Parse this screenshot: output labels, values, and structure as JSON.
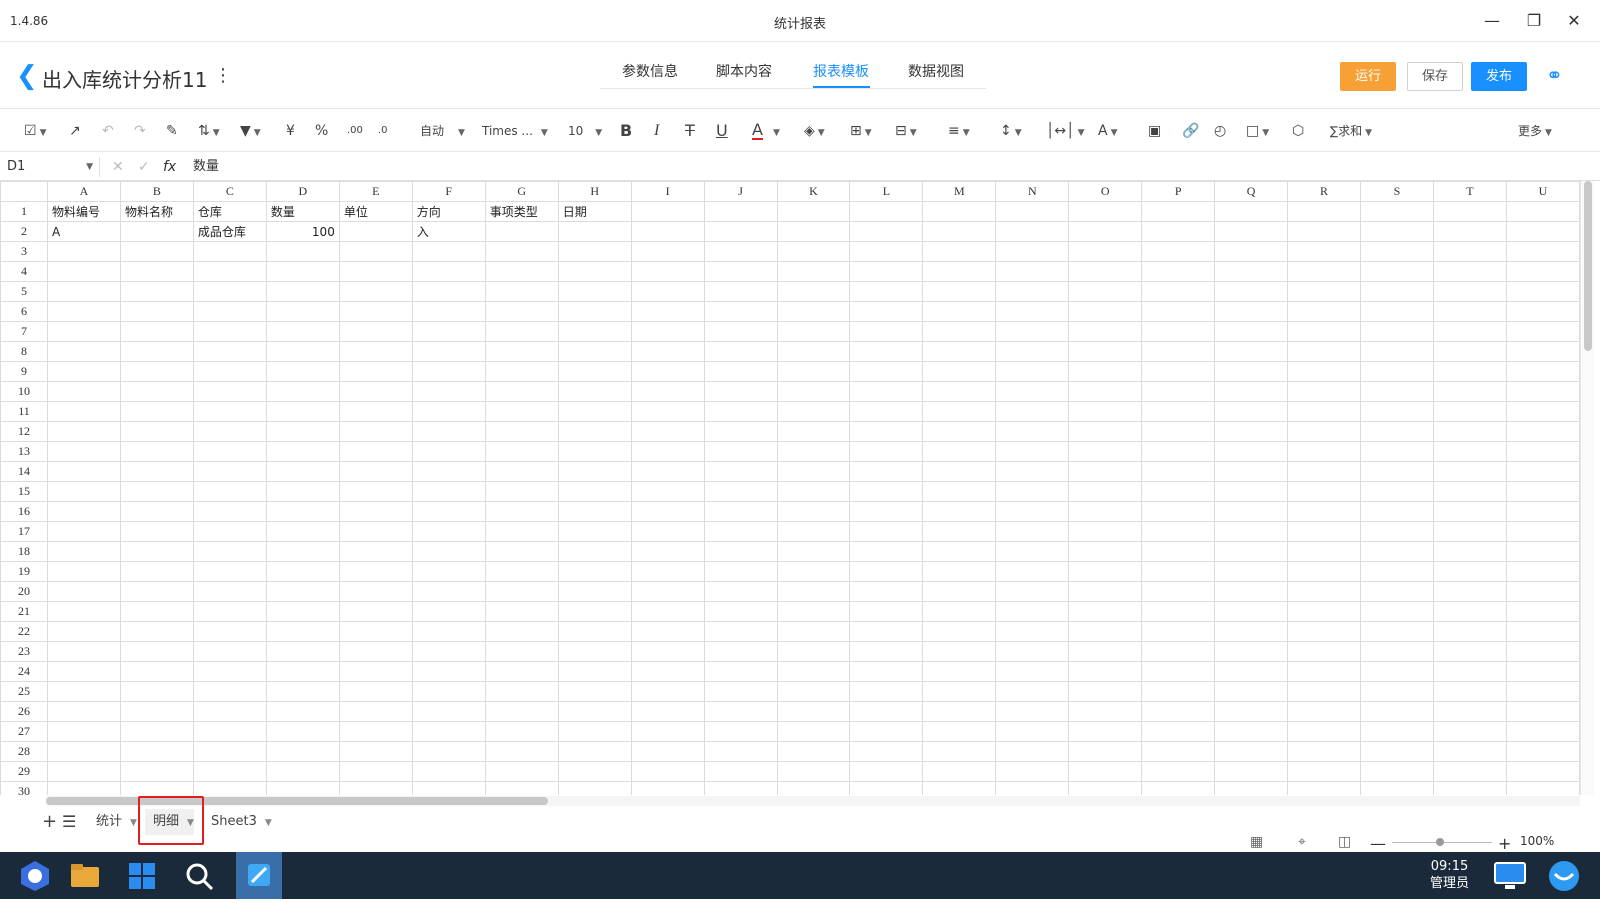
{
  "titlebar": {
    "version": "1.4.86",
    "title": "统计报表"
  },
  "header": {
    "page_title": "出入库统计分析11",
    "tabs": [
      "参数信息",
      "脚本内容",
      "报表模板",
      "数据视图"
    ],
    "active_tab": "报表模板",
    "run_label": "运行",
    "save_label": "保存",
    "publish_label": "发布"
  },
  "toolbar": {
    "currency": "¥",
    "percent": "%",
    "format": "自动",
    "font": "Times ...",
    "size": "10",
    "bold": "B",
    "italic": "I",
    "strike": "T",
    "underline": "U",
    "fontcolor": "A",
    "highlight": "A",
    "sum": "∑求和",
    "more": "更多"
  },
  "formula_bar": {
    "cell_ref": "D1",
    "fx": "fx",
    "value": "数量"
  },
  "columns": [
    "A",
    "B",
    "C",
    "D",
    "E",
    "F",
    "G",
    "H",
    "I",
    "J",
    "K",
    "L",
    "M",
    "N",
    "O",
    "P",
    "Q",
    "R",
    "S",
    "T",
    "U"
  ],
  "rows": [
    [
      "物料编号",
      "物料名称",
      "仓库",
      "数量",
      "单位",
      "方向",
      "事项类型",
      "日期"
    ],
    [
      "A",
      "",
      "成品仓库",
      "100",
      "",
      "入",
      "",
      ""
    ]
  ],
  "row_count": 30,
  "sheets": [
    "统计",
    "明细",
    "Sheet3"
  ],
  "active_sheet": "明细",
  "zoom": "100%",
  "taskbar": {
    "time": "09:15",
    "user": "管理员"
  },
  "colors": {
    "accent": "#1890ff",
    "run": "#f7a035",
    "highlight_box": "#e02020"
  }
}
